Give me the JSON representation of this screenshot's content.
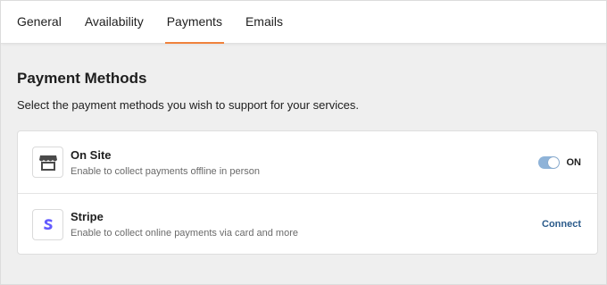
{
  "tabs": [
    {
      "label": "General",
      "active": false
    },
    {
      "label": "Availability",
      "active": false
    },
    {
      "label": "Payments",
      "active": true
    },
    {
      "label": "Emails",
      "active": false
    }
  ],
  "section": {
    "title": "Payment Methods",
    "subtitle": "Select the payment methods you wish to support for your services."
  },
  "methods": [
    {
      "icon": "storefront-icon",
      "title": "On Site",
      "description": "Enable to collect payments offline in person",
      "action": {
        "type": "toggle",
        "state": "on",
        "label": "ON"
      }
    },
    {
      "icon": "stripe-logo-icon",
      "title": "Stripe",
      "description": "Enable to collect online payments via card and more",
      "action": {
        "type": "link",
        "label": "Connect"
      }
    }
  ],
  "colors": {
    "accent_tab_underline": "#f0823c",
    "toggle_on": "#8fb3d8",
    "connect_link": "#2a5a8a",
    "stripe_brand": "#635bff"
  }
}
